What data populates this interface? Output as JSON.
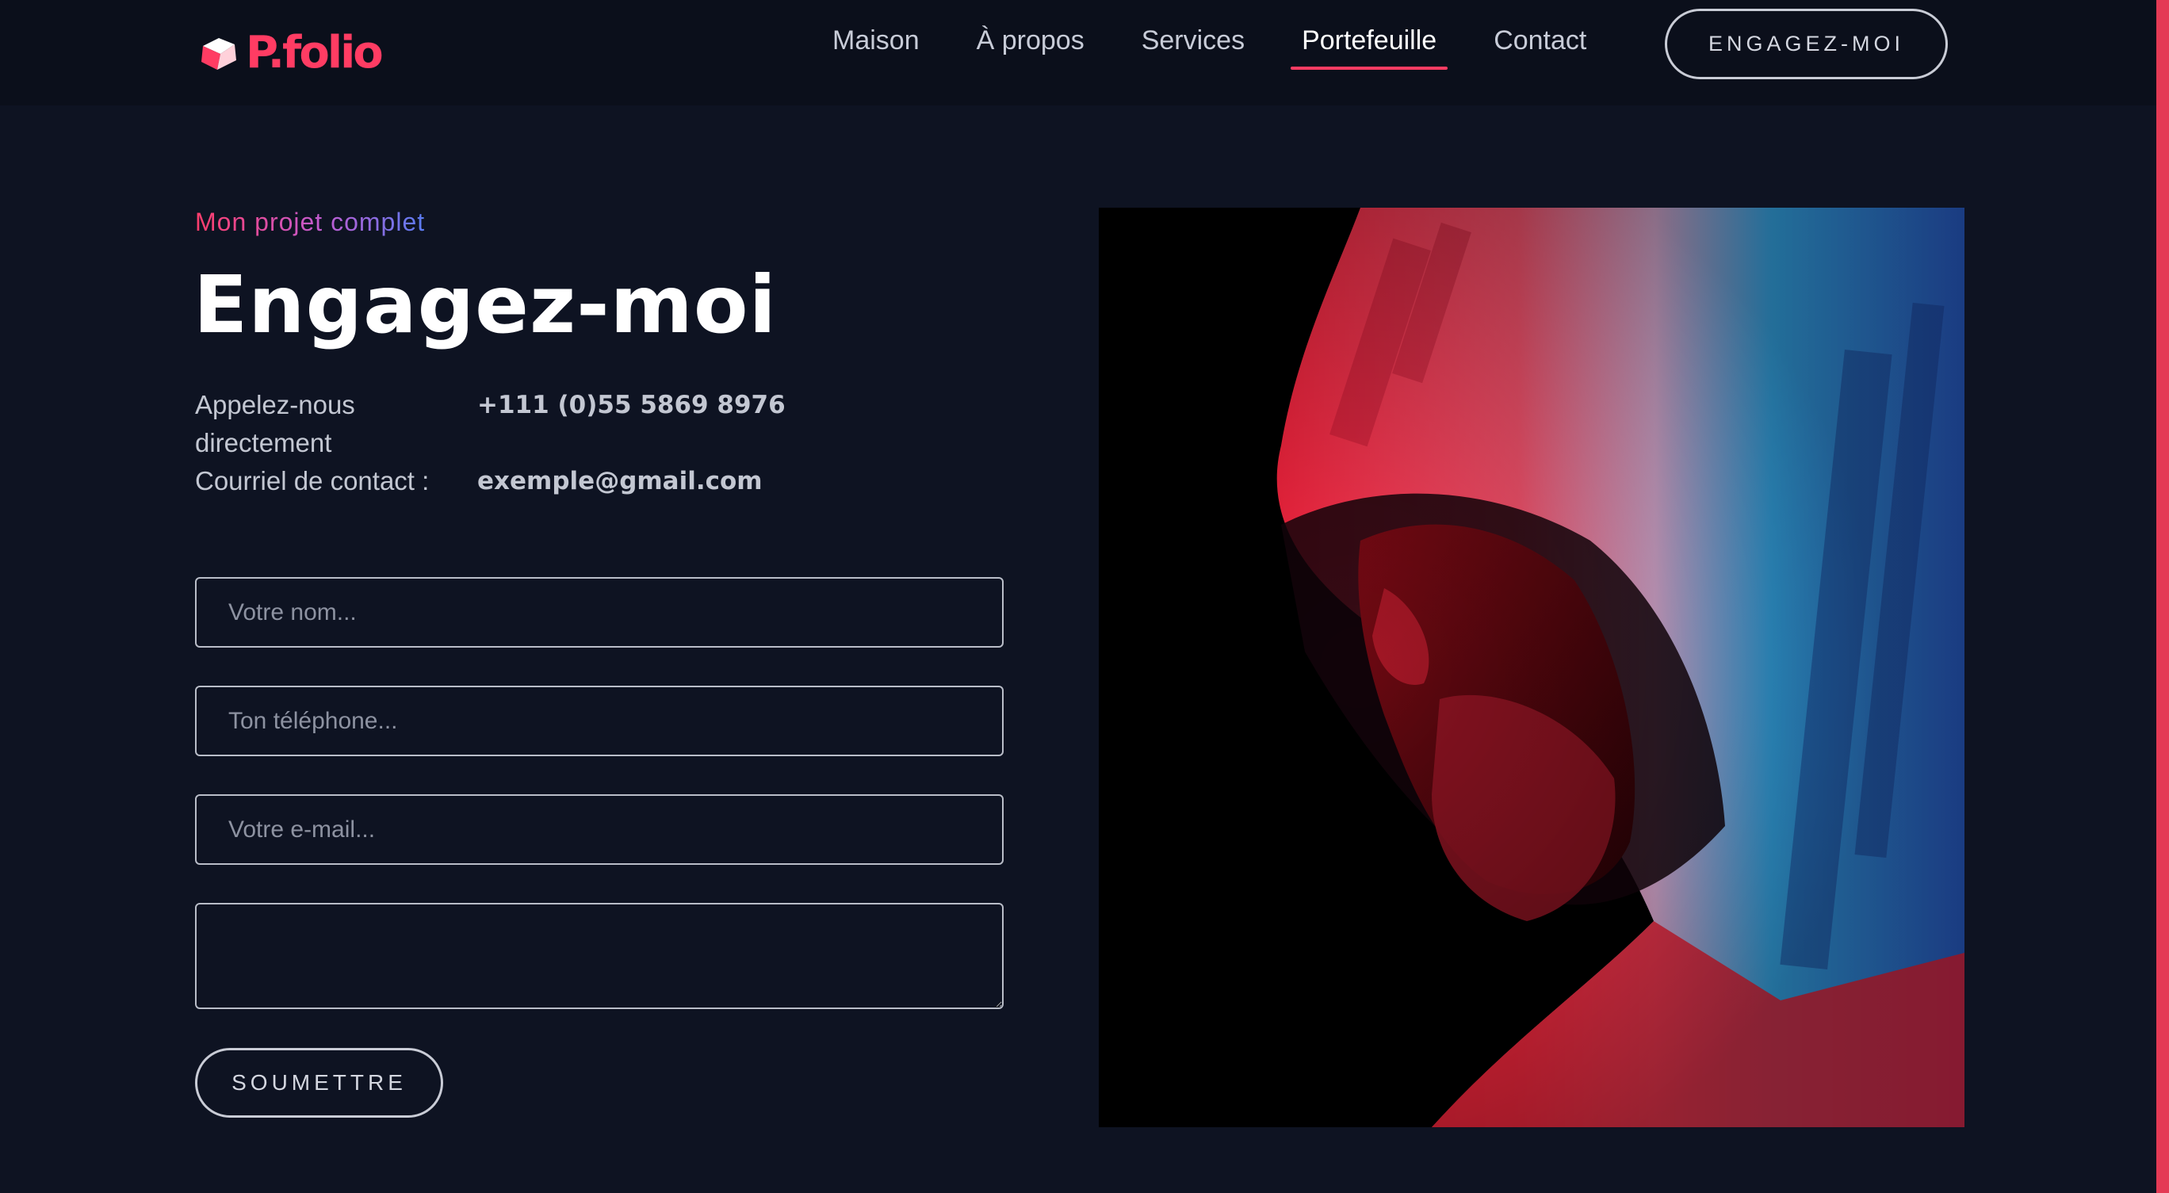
{
  "brand": {
    "name": "P.folio",
    "accent": "#ff3c63"
  },
  "nav": {
    "items": [
      {
        "label": "Maison"
      },
      {
        "label": "À propos"
      },
      {
        "label": "Services"
      },
      {
        "label": "Portefeuille",
        "active": true
      },
      {
        "label": "Contact"
      }
    ],
    "cta_label": "ENGAGEZ-MOI"
  },
  "main": {
    "subtitle": "Mon projet complet",
    "title": "Engagez-moi",
    "contacts": [
      {
        "label": "Appelez-nous directement",
        "value": "+111 (0)55 5869 8976"
      },
      {
        "label": "Courriel de contact :",
        "value": "exemple@gmail.com"
      }
    ],
    "form": {
      "name_placeholder": "Votre nom...",
      "phone_placeholder": "Ton téléphone...",
      "email_placeholder": "Votre e-mail...",
      "message_placeholder": "",
      "submit_label": "SOUMETTRE"
    }
  },
  "colors": {
    "background": "#0e1322",
    "header_background": "#0b0f1b",
    "gradient_start": "#ff3d6b",
    "gradient_end": "#5a7cf2"
  }
}
